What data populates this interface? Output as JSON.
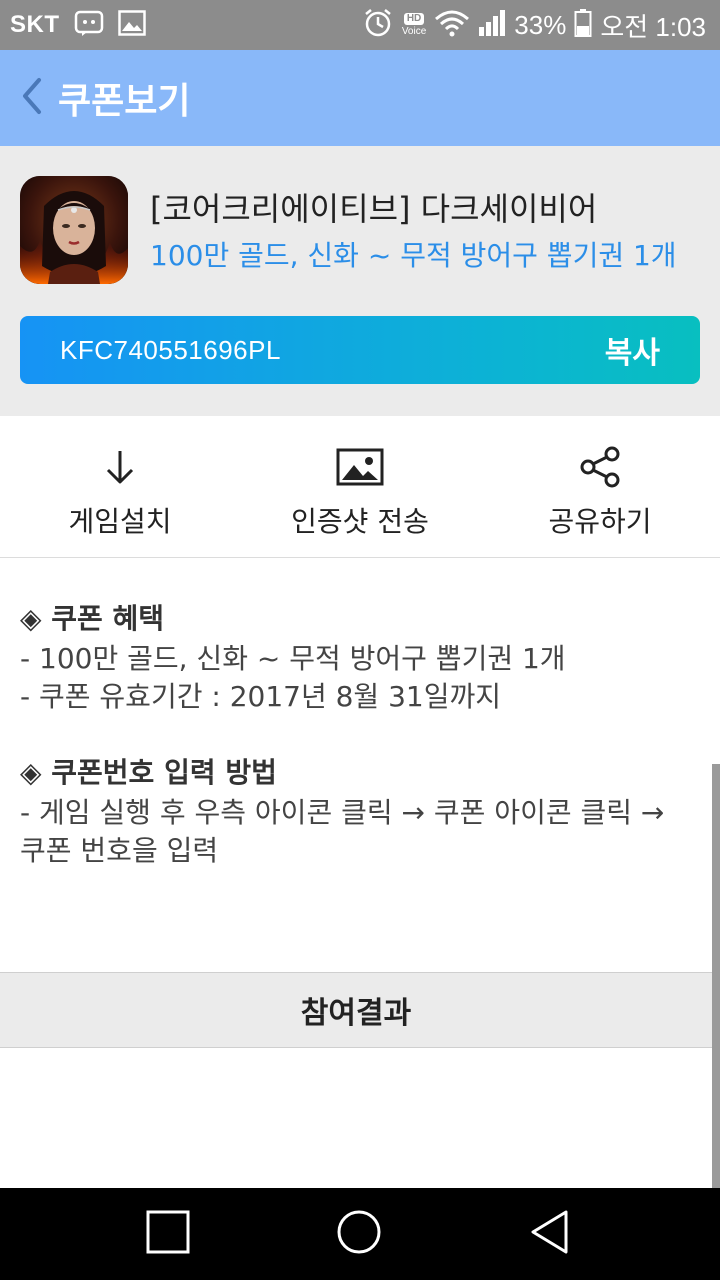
{
  "status_bar": {
    "carrier": "SKT",
    "hd_label": "HD",
    "voice_label": "Voice",
    "battery": "33%",
    "time": "오전 1:03",
    "icons": [
      "chat-icon",
      "image-icon",
      "alarm-icon",
      "hd-voice-icon",
      "wifi-icon",
      "signal-icon",
      "battery-icon"
    ]
  },
  "app_bar": {
    "title": "쿠폰보기",
    "back_icon": "chevron-left-icon"
  },
  "header": {
    "game_title": "[코어크리에이티브] 다크세이비어",
    "reward": "100만 골드, 신화 ~ 무적 방어구 뽑기권 1개",
    "coupon_code": "KFC740551696PL",
    "copy_label": "복사"
  },
  "actions": [
    {
      "icon": "download-icon",
      "label": "게임설치"
    },
    {
      "icon": "image-icon",
      "label": "인증샷 전송"
    },
    {
      "icon": "share-icon",
      "label": "공유하기"
    }
  ],
  "content": {
    "benefit_heading": "◈ 쿠폰 혜택",
    "benefit_lines": [
      "- 100만 골드, 신화 ~ 무적 방어구 뽑기권 1개",
      "- 쿠폰 유효기간 : 2017년 8월 31일까지"
    ],
    "method_heading": "◈ 쿠폰번호 입력 방법",
    "method_lines": [
      "- 게임 실행 후 우측 아이콘 클릭 → 쿠폰 아이콘 클릭 →",
      "쿠폰 번호을 입력"
    ]
  },
  "result_label": "참여결과",
  "nav": [
    "recent-apps-icon",
    "home-icon",
    "back-icon"
  ],
  "colors": {
    "status_bar": "#8c8c8c",
    "app_bar": "#89b8f9",
    "accent_blue": "#2b8ee8",
    "code_gradient_start": "#1693f5",
    "code_gradient_end": "#08bfc0"
  }
}
